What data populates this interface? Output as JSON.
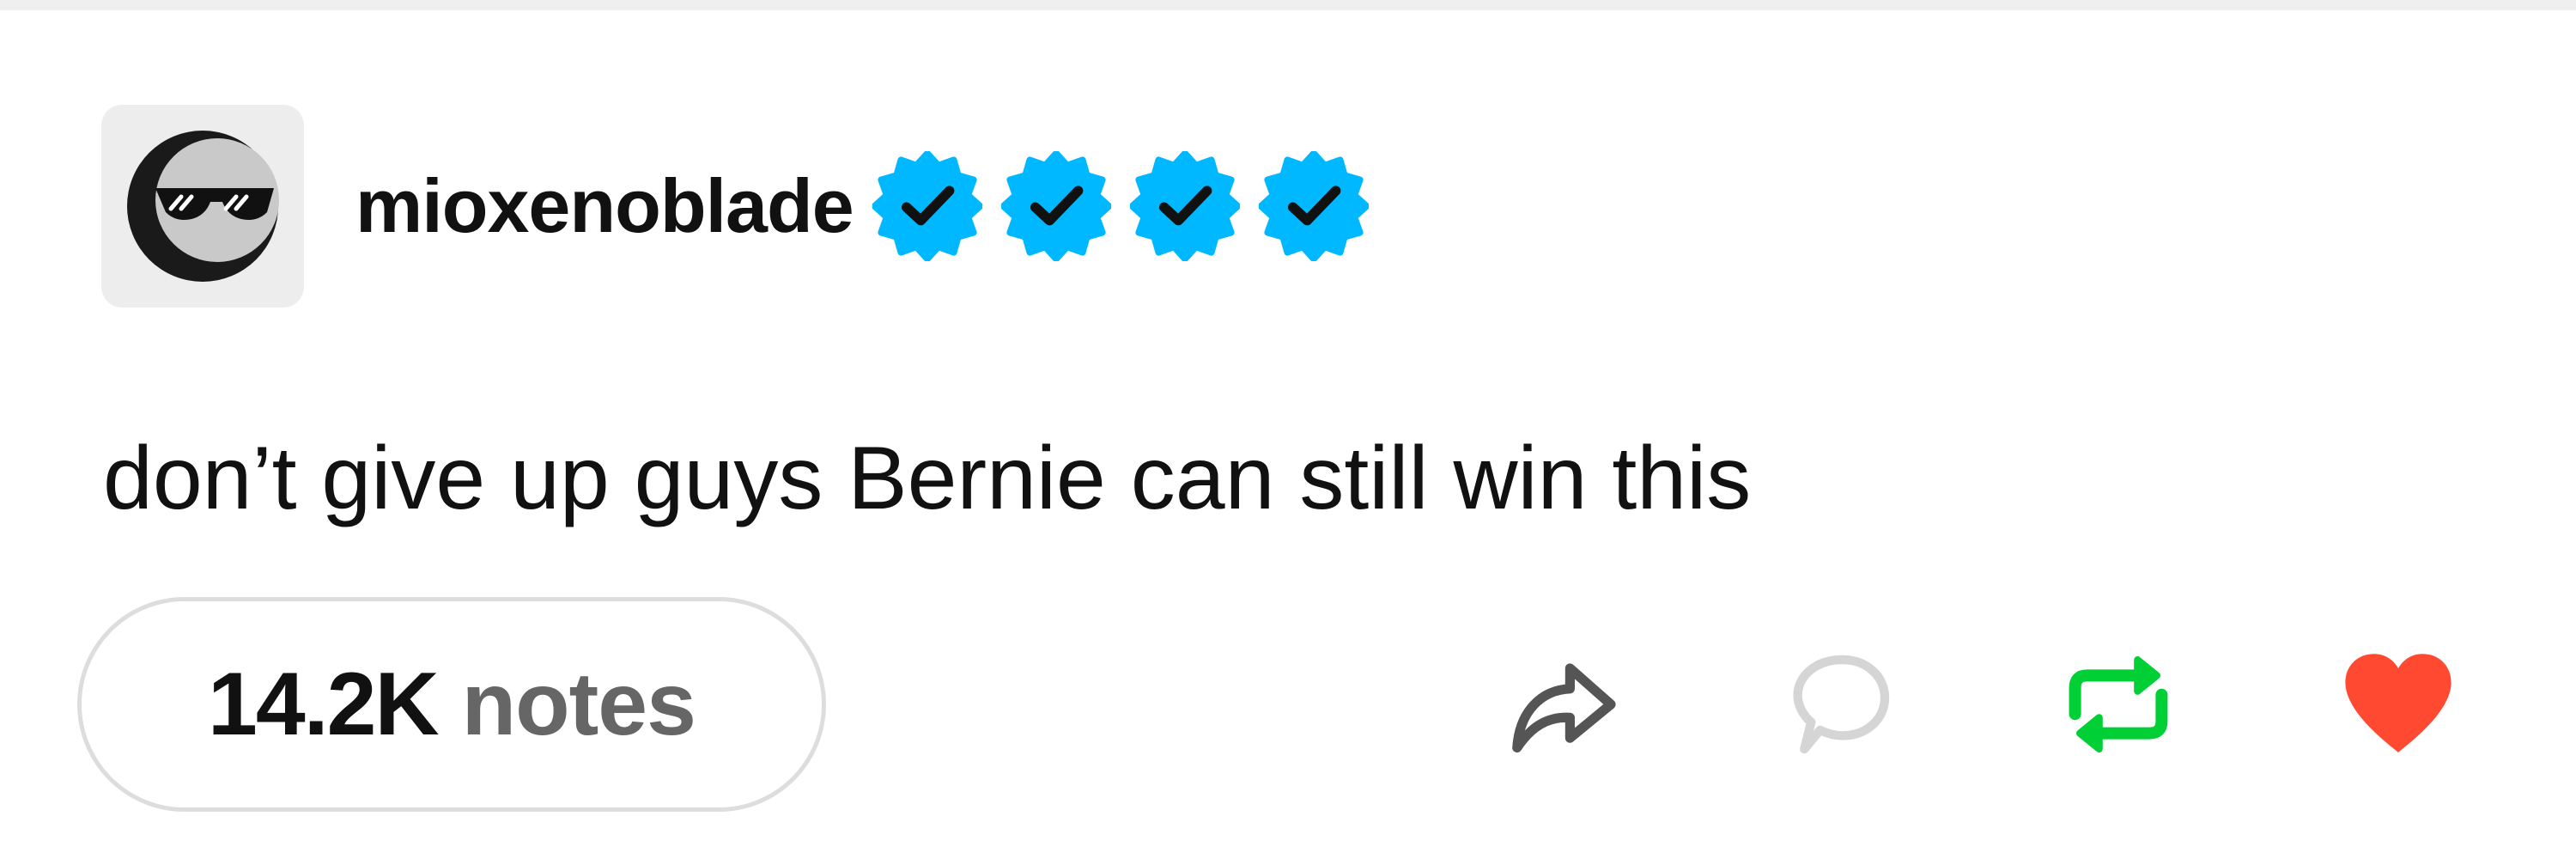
{
  "post": {
    "username": "mioxenoblade",
    "badge_count": 4,
    "body_text": "don’t give up guys Bernie can still win this",
    "notes_count": "14.2K",
    "notes_label": "notes"
  },
  "icons": {
    "avatar": "sunglasses-moon-avatar",
    "badge": "verified-badge-icon",
    "share": "share-arrow-icon",
    "reply": "reply-bubble-icon",
    "reblog": "reblog-icon",
    "like": "heart-icon"
  },
  "colors": {
    "badge_blue": "#00b8ff",
    "reblog_green": "#00cf35",
    "like_red": "#ff4930",
    "icon_gray": "#555555",
    "reply_light_gray": "#d5d5d5",
    "pill_border": "#dddddd"
  }
}
